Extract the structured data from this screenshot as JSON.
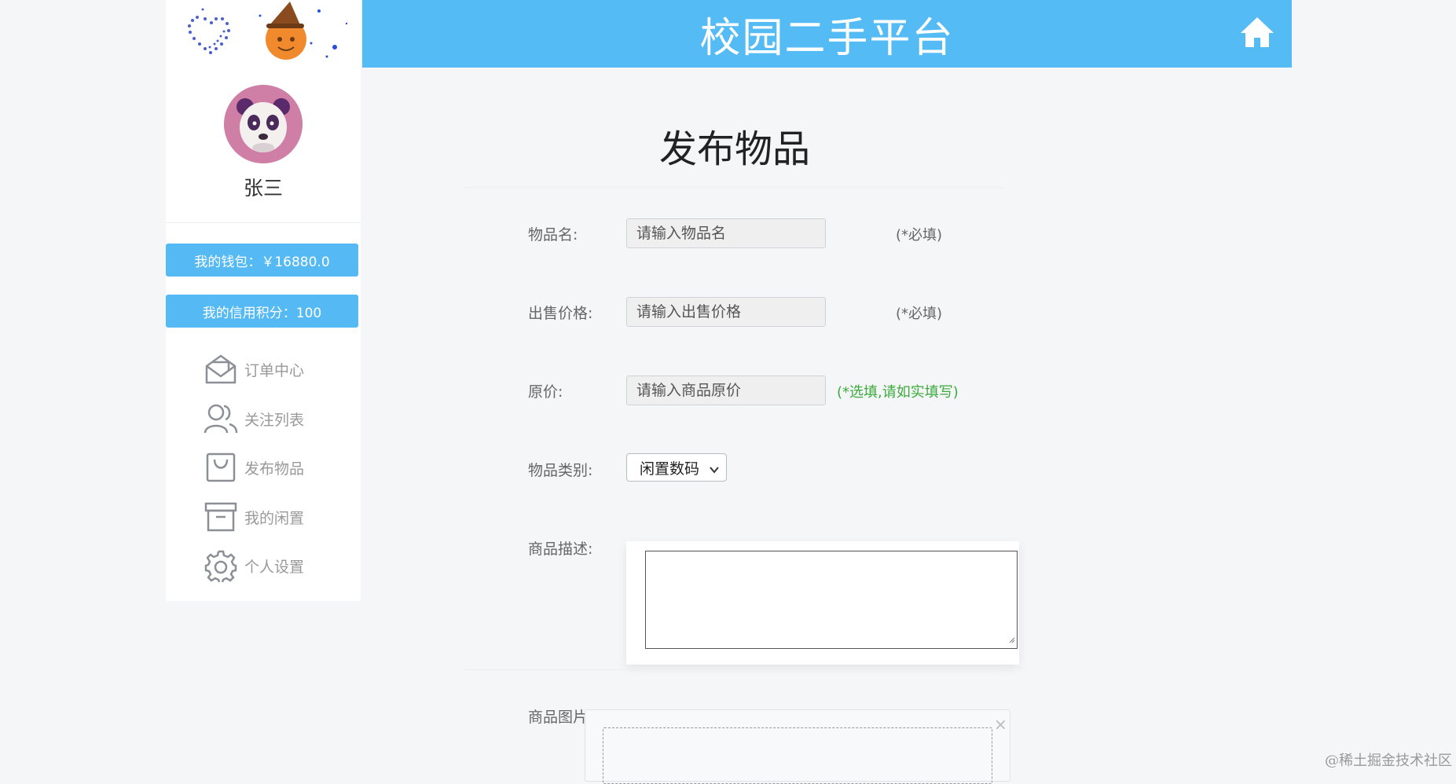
{
  "header": {
    "title": "校园二手平台",
    "home_icon": "home-icon"
  },
  "sidebar": {
    "username": "张三",
    "wallet_label": "我的钱包：￥16880.0",
    "credit_label": "我的信用积分：100",
    "nav": [
      {
        "label": "订单中心",
        "icon": "envelope-open-icon"
      },
      {
        "label": "关注列表",
        "icon": "users-icon"
      },
      {
        "label": "发布物品",
        "icon": "shopping-bag-icon"
      },
      {
        "label": "我的闲置",
        "icon": "archive-box-icon"
      },
      {
        "label": "个人设置",
        "icon": "gear-icon"
      }
    ]
  },
  "form": {
    "title": "发布物品",
    "name": {
      "label": "物品名:",
      "placeholder": "请输入物品名",
      "hint": "(*必填)"
    },
    "price": {
      "label": "出售价格:",
      "placeholder": "请输入出售价格",
      "hint": "(*必填)"
    },
    "original_price": {
      "label": "原价:",
      "placeholder": "请输入商品原价",
      "hint": "(*选填,请如实填写)"
    },
    "category": {
      "label": "物品类别:",
      "selected": "闲置数码"
    },
    "description": {
      "label": "商品描述:",
      "value": ""
    },
    "image": {
      "label": "商品图片:",
      "close_glyph": "×"
    }
  },
  "watermark": "@稀土掘金技术社区",
  "colors": {
    "accent": "#55bbf4",
    "optional_hint": "#3caa3c",
    "page_bg": "#f5f6f8"
  }
}
